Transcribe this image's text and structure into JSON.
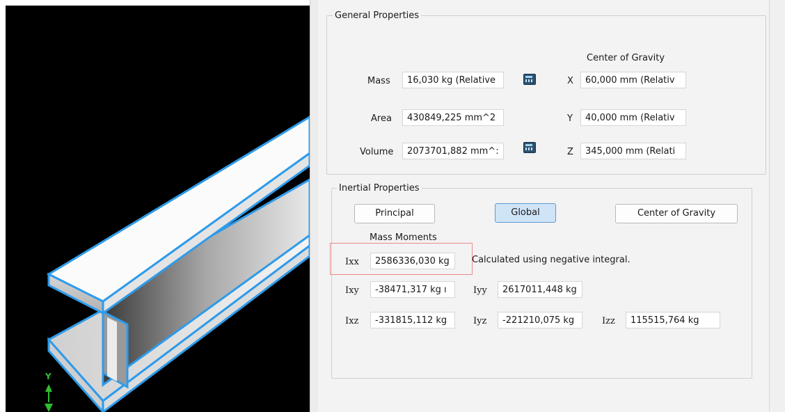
{
  "general": {
    "legend": "General Properties",
    "cog_header": "Center of Gravity",
    "mass": {
      "label": "Mass",
      "value": "16,030 kg (Relative"
    },
    "area": {
      "label": "Area",
      "value": "430849,225 mm^2"
    },
    "volume": {
      "label": "Volume",
      "value": "2073701,882 mm^:"
    },
    "x": {
      "label": "X",
      "value": "60,000 mm (Relativ"
    },
    "y": {
      "label": "Y",
      "value": "40,000 mm (Relativ"
    },
    "z": {
      "label": "Z",
      "value": "345,000 mm (Relati"
    }
  },
  "inertial": {
    "legend": "Inertial Properties",
    "buttons": {
      "principal": "Principal",
      "global": "Global",
      "cog": "Center of Gravity"
    },
    "mass_moments": "Mass Moments",
    "note": "Calculated using negative integral.",
    "ixx": {
      "label": "Ixx",
      "value": "2586336,030 kg"
    },
    "ixy": {
      "label": "Ixy",
      "value": "-38471,317 kg ı"
    },
    "iyy": {
      "label": "Iyy",
      "value": "2617011,448 kg"
    },
    "ixz": {
      "label": "Ixz",
      "value": "-331815,112 kg"
    },
    "iyz": {
      "label": "Iyz",
      "value": "-221210,075 kg"
    },
    "izz": {
      "label": "Izz",
      "value": "115515,764 kg"
    }
  },
  "viewport": {
    "axis_label": "Y"
  },
  "colors": {
    "edge": "#2e9bea",
    "active_button": "#cfe4f7",
    "highlight": "#e98b8b"
  }
}
